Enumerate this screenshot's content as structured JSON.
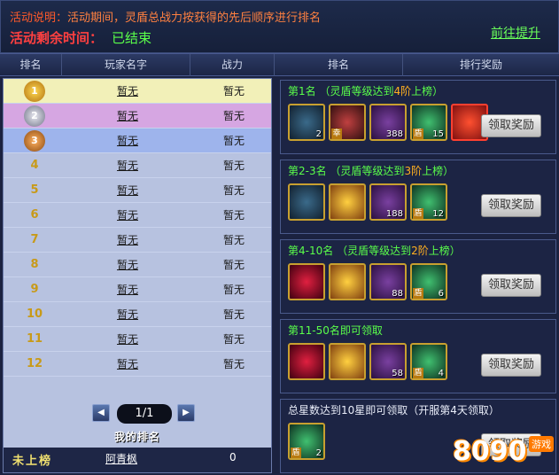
{
  "top": {
    "desc_label": "活动说明：",
    "desc_text": "活动期间，灵盾总战力按获得的先后顺序进行排名",
    "remain_label": "活动剩余时间：",
    "remain_value": "已结束",
    "goto_link": "前往提升"
  },
  "headers": {
    "rank": "排名",
    "player_name": "玩家名字",
    "power": "战力",
    "rank2": "排名",
    "reward": "排行奖励"
  },
  "ranking": [
    {
      "rank": "1",
      "name": "暂无",
      "power": "暂无"
    },
    {
      "rank": "2",
      "name": "暂无",
      "power": "暂无"
    },
    {
      "rank": "3",
      "name": "暂无",
      "power": "暂无"
    },
    {
      "rank": "4",
      "name": "暂无",
      "power": "暂无"
    },
    {
      "rank": "5",
      "name": "暂无",
      "power": "暂无"
    },
    {
      "rank": "6",
      "name": "暂无",
      "power": "暂无"
    },
    {
      "rank": "7",
      "name": "暂无",
      "power": "暂无"
    },
    {
      "rank": "8",
      "name": "暂无",
      "power": "暂无"
    },
    {
      "rank": "9",
      "name": "暂无",
      "power": "暂无"
    },
    {
      "rank": "10",
      "name": "暂无",
      "power": "暂无"
    },
    {
      "rank": "11",
      "name": "暂无",
      "power": "暂无"
    },
    {
      "rank": "12",
      "name": "暂无",
      "power": "暂无"
    }
  ],
  "pager": {
    "value": "1/1",
    "prev_icon": "◀",
    "next_icon": "▶"
  },
  "my_rank": {
    "label": "我的排名",
    "status": "未上榜",
    "name": "阿青枫",
    "power": "0"
  },
  "rewards": [
    {
      "title_a": "第1名",
      "title_b": " （灵盾等级达到",
      "title_c": "4阶",
      "title_d": "上榜）",
      "button": "领取奖励",
      "items": [
        {
          "icon": "treasure-chest-icon",
          "count": "2",
          "tag": ""
        },
        {
          "icon": "character-portrait-icon",
          "count": "",
          "tag": "幸"
        },
        {
          "icon": "iron-ore-icon",
          "count": "388",
          "tag": ""
        },
        {
          "icon": "green-gem-icon",
          "count": "15",
          "tag": "盾"
        },
        {
          "icon": "red-emblem-icon",
          "count": "",
          "tag": ""
        }
      ]
    },
    {
      "title_a": "第2-3名",
      "title_b": " （灵盾等级达到",
      "title_c": "3阶",
      "title_d": "上榜）",
      "button": "领取奖励",
      "items": [
        {
          "icon": "treasure-chest-icon",
          "count": "",
          "tag": ""
        },
        {
          "icon": "golden-orb-icon",
          "count": "",
          "tag": ""
        },
        {
          "icon": "iron-ore-icon",
          "count": "188",
          "tag": ""
        },
        {
          "icon": "green-gem-icon",
          "count": "12",
          "tag": "盾"
        }
      ]
    },
    {
      "title_a": "第4-10名",
      "title_b": " （灵盾等级达到",
      "title_c": "2阶",
      "title_d": "上榜）",
      "button": "领取奖励",
      "items": [
        {
          "icon": "red-triangle-gem-icon",
          "count": "",
          "tag": ""
        },
        {
          "icon": "golden-orb-icon",
          "count": "",
          "tag": ""
        },
        {
          "icon": "iron-ore-icon",
          "count": "88",
          "tag": ""
        },
        {
          "icon": "green-gem-icon",
          "count": "6",
          "tag": "盾"
        }
      ]
    },
    {
      "title_a": "第11-50名",
      "title_b": "即可领取",
      "title_c": "",
      "title_d": "",
      "button": "领取奖励",
      "items": [
        {
          "icon": "red-gem-icon",
          "count": "",
          "tag": ""
        },
        {
          "icon": "golden-orb-icon",
          "count": "",
          "tag": ""
        },
        {
          "icon": "iron-ore-icon",
          "count": "58",
          "tag": ""
        },
        {
          "icon": "green-gem-icon",
          "count": "4",
          "tag": "盾"
        }
      ]
    },
    {
      "title_a": "总星数达到10星即可领取（开服第4天领取）",
      "title_b": "",
      "title_c": "",
      "title_d": "",
      "button": "领取奖励",
      "items": [
        {
          "icon": "green-gem-icon",
          "count": "2",
          "tag": "盾"
        }
      ]
    }
  ],
  "watermark": {
    "text": "8090",
    "sub": "游戏"
  }
}
